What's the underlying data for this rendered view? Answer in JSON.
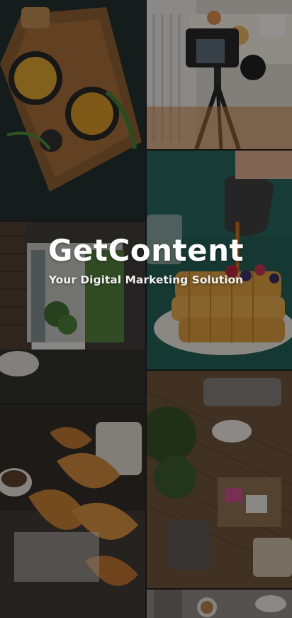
{
  "brand": {
    "title": "GetContent",
    "tagline": "Your Digital Marketing Solution"
  },
  "gallery": {
    "tiles": [
      {
        "name": "soup-bowls-photo"
      },
      {
        "name": "camera-tripod-photo"
      },
      {
        "name": "interior-garden-photo"
      },
      {
        "name": "waffles-syrup-photo"
      },
      {
        "name": "croissants-photo"
      },
      {
        "name": "living-room-aerial-photo"
      },
      {
        "name": "cafe-table-photo"
      }
    ]
  },
  "colors": {
    "overlay": "#0a0a0a",
    "text": "#ffffff"
  }
}
